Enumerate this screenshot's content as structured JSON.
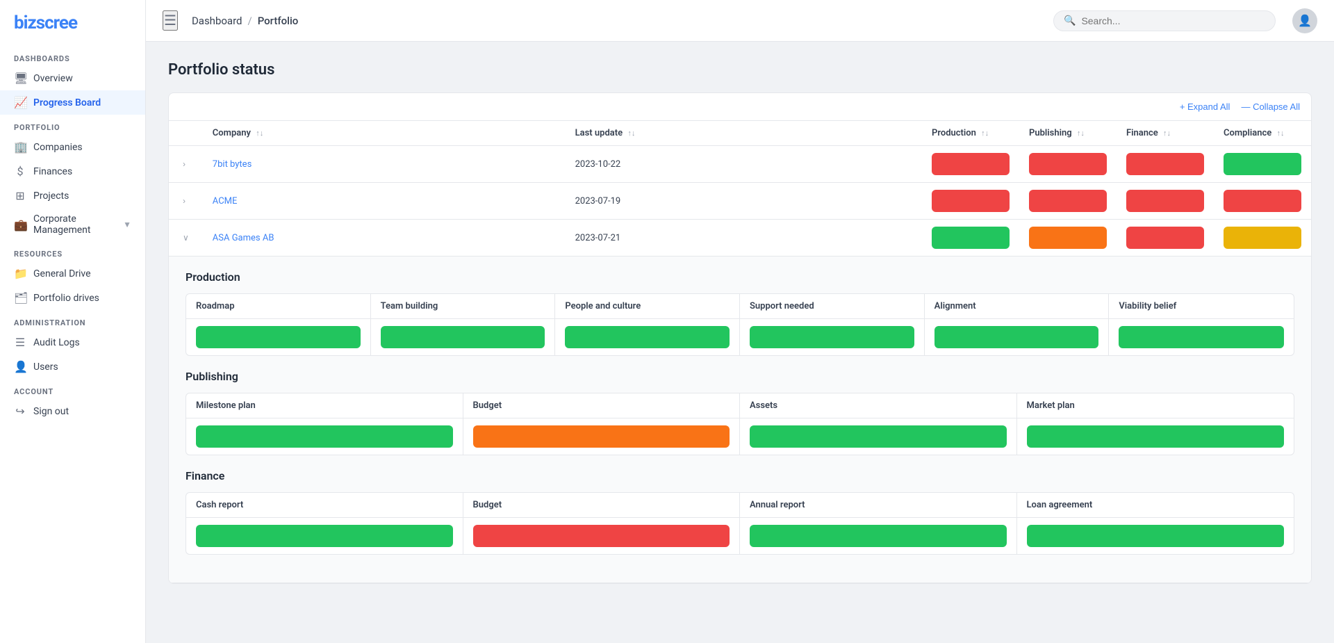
{
  "app": {
    "name": "bizscree"
  },
  "topbar": {
    "breadcrumb_home": "Dashboard",
    "breadcrumb_sep": "/",
    "breadcrumb_current": "Portfolio",
    "search_placeholder": "Search..."
  },
  "sidebar": {
    "dashboards_label": "DASHBOARDS",
    "overview_label": "Overview",
    "progress_board_label": "Progress Board",
    "portfolio_label": "PORTFOLIO",
    "companies_label": "Companies",
    "finances_label": "Finances",
    "projects_label": "Projects",
    "corporate_management_label": "Corporate Management",
    "resources_label": "RESOURCES",
    "general_drive_label": "General Drive",
    "portfolio_drives_label": "Portfolio drives",
    "administration_label": "ADMINISTRATION",
    "audit_logs_label": "Audit Logs",
    "users_label": "Users",
    "account_label": "ACCOUNT",
    "sign_out_label": "Sign out"
  },
  "page": {
    "title": "Portfolio status"
  },
  "table_actions": {
    "expand_all": "+ Expand All",
    "collapse_all": "— Collapse All"
  },
  "table": {
    "headers": {
      "company": "Company",
      "last_update": "Last update",
      "production": "Production",
      "publishing": "Publishing",
      "finance": "Finance",
      "compliance": "Compliance"
    },
    "rows": [
      {
        "id": "7bit-bytes",
        "name": "7bit bytes",
        "last_update": "2023-10-22",
        "production_status": "red",
        "publishing_status": "red",
        "finance_status": "red",
        "compliance_status": "green",
        "expanded": false
      },
      {
        "id": "acme",
        "name": "ACME",
        "last_update": "2023-07-19",
        "production_status": "red",
        "publishing_status": "red",
        "finance_status": "red",
        "compliance_status": "red",
        "expanded": false
      },
      {
        "id": "asa-games",
        "name": "ASA Games AB",
        "last_update": "2023-07-21",
        "production_status": "green",
        "publishing_status": "orange",
        "finance_status": "red",
        "compliance_status": "yellow",
        "expanded": true
      }
    ]
  },
  "expanded_row": {
    "production": {
      "title": "Production",
      "columns": [
        "Roadmap",
        "Team building",
        "People and culture",
        "Support needed",
        "Alignment",
        "Viability belief"
      ],
      "values": [
        "green",
        "green",
        "green",
        "green",
        "green",
        "green"
      ]
    },
    "publishing": {
      "title": "Publishing",
      "columns": [
        "Milestone plan",
        "Budget",
        "Assets",
        "Market plan"
      ],
      "values": [
        "green",
        "orange",
        "green",
        "green"
      ]
    },
    "finance": {
      "title": "Finance",
      "columns": [
        "Cash report",
        "Budget",
        "Annual report",
        "Loan agreement"
      ],
      "values": [
        "green",
        "red",
        "green",
        "green"
      ]
    }
  },
  "colors": {
    "red": "#ef4444",
    "green": "#22c55e",
    "orange": "#f97316",
    "yellow": "#eab308",
    "brand_blue": "#3b82f6"
  }
}
